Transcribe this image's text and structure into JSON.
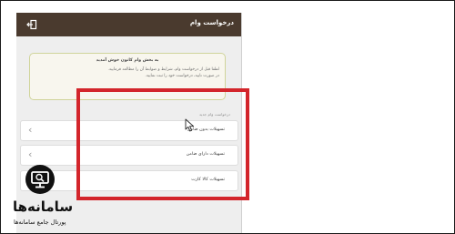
{
  "header": {
    "title": "درخواست وام",
    "exit_icon": "exit-icon"
  },
  "welcome": {
    "title": "به بخش وام کانون خوش آمدید",
    "body": "لطفا قبل از درخواست وام، شرایط و ضوابط آن را مطالعه فرمایید.\nدر صورت تایید، درخواست خود را ثبت نمایید."
  },
  "loans": {
    "section_label": "درخواست وام جدید",
    "items": [
      {
        "label": "تسهیلات بدون ضامن",
        "icon": "chevron-left-icon"
      },
      {
        "label": "تسهیلات دارای ضامن",
        "icon": "chevron-left-icon"
      },
      {
        "label": "تسهیلات کالا کارت",
        "icon": "chevron-left-icon"
      }
    ]
  },
  "watermark": {
    "name": "سامانه‌ها",
    "tagline": "پورتال جامع سامانه‌ها"
  },
  "colors": {
    "header": "#4a3a2e",
    "highlight": "#d3252b",
    "welcome_border": "#d0d49a",
    "app_background": "#eeeeee"
  }
}
